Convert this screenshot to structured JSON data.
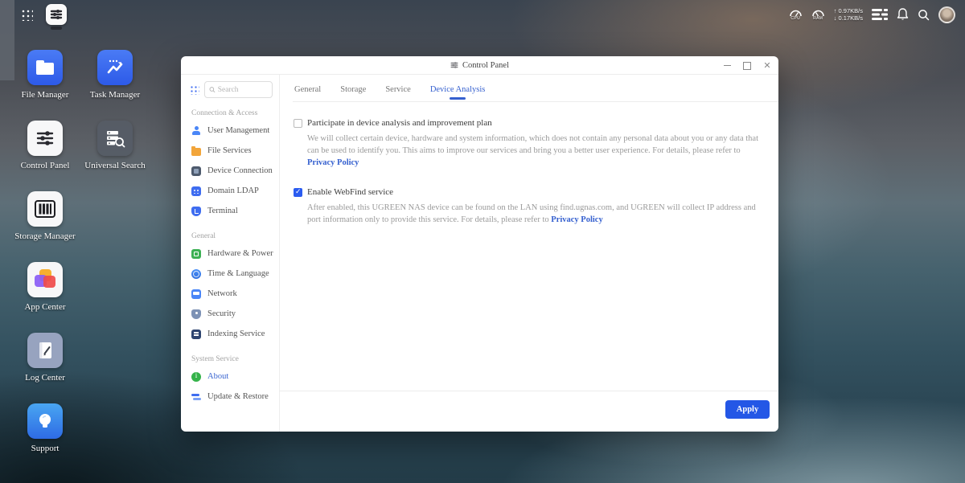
{
  "topbar": {
    "cpu_label": "CPU",
    "ram_label": "RAM",
    "upload_speed": "↑ 0.97KB/s",
    "download_speed": "↓ 0.17KB/s",
    "icons": [
      "apps-grid-icon",
      "cpu-gauge-icon",
      "ram-gauge-icon",
      "widgets-icon",
      "bell-icon",
      "search-icon",
      "avatar"
    ]
  },
  "desktop": {
    "icons": [
      {
        "label": "File Manager"
      },
      {
        "label": "Task Manager"
      },
      {
        "label": "Control Panel"
      },
      {
        "label": "Universal Search"
      },
      {
        "label": "Storage Manager"
      },
      {
        "label": "App Center"
      },
      {
        "label": "Log Center"
      },
      {
        "label": "Support"
      }
    ]
  },
  "window": {
    "title": "Control Panel",
    "controls": [
      "minimize",
      "maximize",
      "close"
    ],
    "sidebar": {
      "search_placeholder": "Search",
      "sections": [
        {
          "header": "Connection & Access",
          "items": [
            {
              "label": "User Management",
              "icon": "user-icon"
            },
            {
              "label": "File Services",
              "icon": "folder-icon"
            },
            {
              "label": "Device Connection",
              "icon": "device-icon"
            },
            {
              "label": "Domain LDAP",
              "icon": "domain-icon"
            },
            {
              "label": "Terminal",
              "icon": "shield-icon"
            }
          ]
        },
        {
          "header": "General",
          "items": [
            {
              "label": "Hardware & Power",
              "icon": "hardware-icon"
            },
            {
              "label": "Time & Language",
              "icon": "globe-icon"
            },
            {
              "label": "Network",
              "icon": "network-icon"
            },
            {
              "label": "Security",
              "icon": "security-shield-icon"
            },
            {
              "label": "Indexing Service",
              "icon": "indexing-icon"
            }
          ]
        },
        {
          "header": "System Service",
          "items": [
            {
              "label": "About",
              "icon": "info-icon",
              "active": true
            },
            {
              "label": "Update & Restore",
              "icon": "update-arrows-icon"
            }
          ]
        }
      ]
    },
    "tabs": [
      {
        "label": "General"
      },
      {
        "label": "Storage"
      },
      {
        "label": "Service"
      },
      {
        "label": "Device Analysis",
        "active": true
      }
    ],
    "content": {
      "options": [
        {
          "checked": false,
          "label": "Participate in device analysis and improvement plan",
          "description": "We will collect certain device, hardware and system information, which does not contain any personal data about you or any data that can be used to identify you. This aims to improve our services and bring you a better user experience. For details, please refer to ",
          "link": "Privacy Policy"
        },
        {
          "checked": true,
          "label": "Enable WebFind service",
          "description": "After enabled, this UGREEN NAS device can be found on the LAN using find.ugnas.com, and UGREEN will collect IP address and port information only to provide this service. For details, please refer to ",
          "link": "Privacy Policy"
        }
      ],
      "apply_label": "Apply"
    }
  },
  "colors": {
    "accent": "#2457e6",
    "link": "#3560cf",
    "active_tab": "#3560cf"
  }
}
